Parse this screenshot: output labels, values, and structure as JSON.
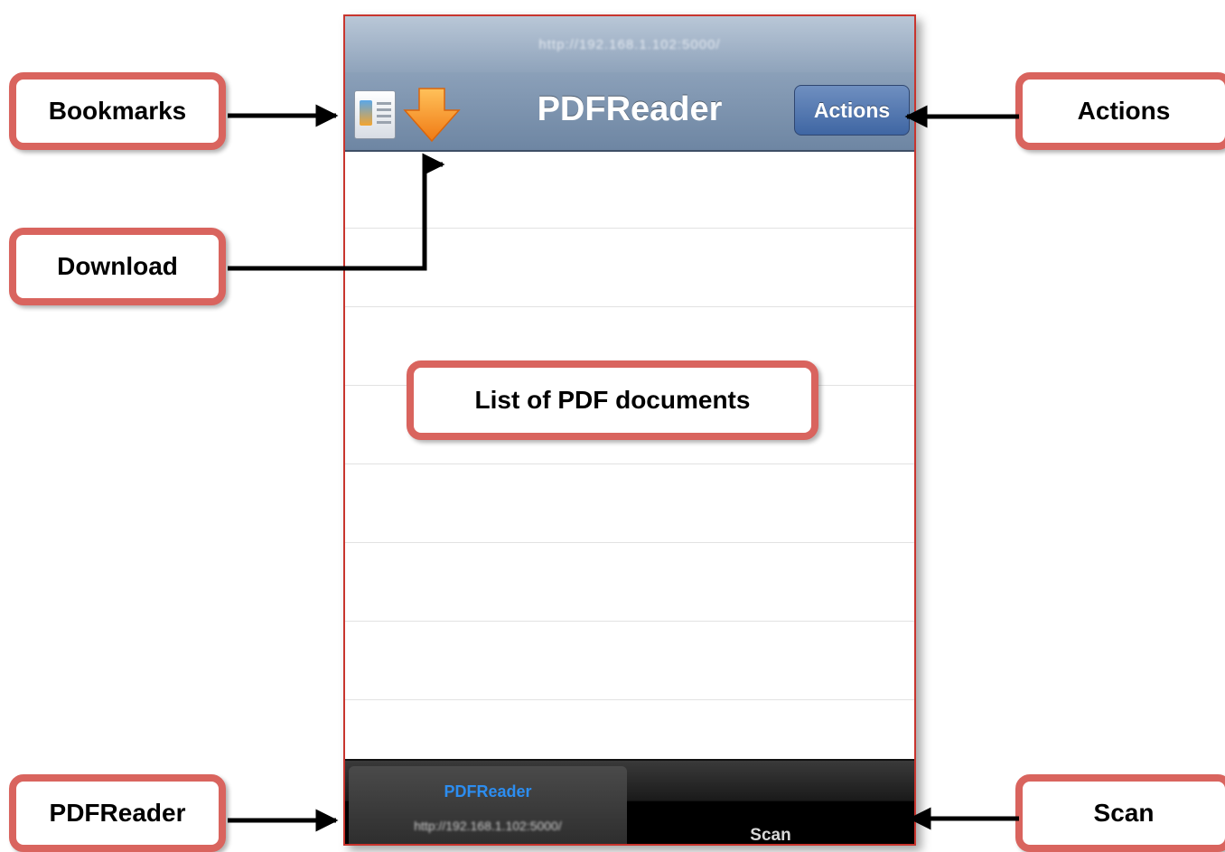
{
  "phone": {
    "url": "http://192.168.1.102:5000/",
    "title": "PDFReader",
    "actions_label": "Actions",
    "tabs": [
      {
        "label": "PDFReader",
        "subtitle": "http://192.168.1.102:5000/",
        "selected": true
      },
      {
        "label": "Scan",
        "selected": false
      }
    ],
    "list_rows": 8
  },
  "callouts": {
    "bookmarks": "Bookmarks",
    "download": "Download",
    "list": "List of PDF documents",
    "actions": "Actions",
    "pdfreader": "PDFReader",
    "scan": "Scan"
  },
  "colors": {
    "callout_border": "#d9645e",
    "phone_border": "#c8352e",
    "nav_bar": "#7c93ae",
    "actions_button": "#4f73ad",
    "tab_active_label": "#2c8df0"
  }
}
